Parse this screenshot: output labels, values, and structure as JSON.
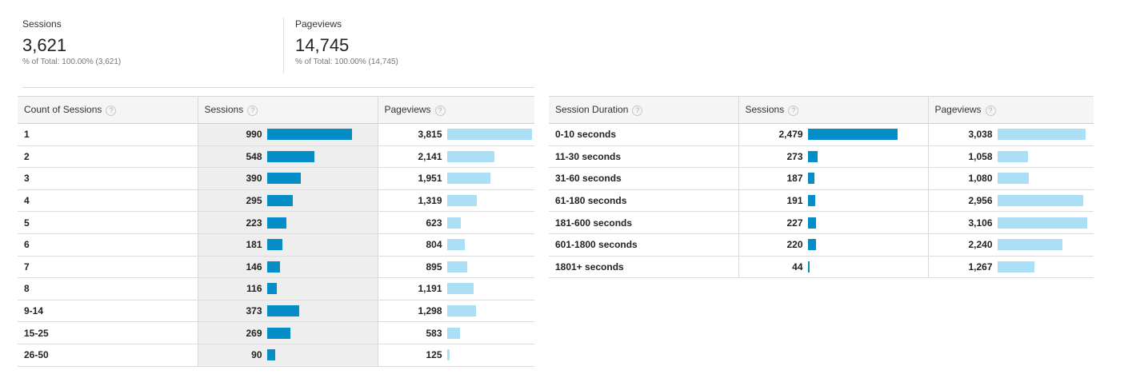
{
  "summary": {
    "sessions": {
      "label": "Sessions",
      "value": "3,621",
      "sub": "% of Total: 100.00% (3,621)"
    },
    "pageviews": {
      "label": "Pageviews",
      "value": "14,745",
      "sub": "% of Total: 100.00% (14,745)"
    }
  },
  "colors": {
    "sessions_bar": "#058dc7",
    "pageviews_bar": "#aadff5"
  },
  "help_icon": "?",
  "table_count": {
    "headers": [
      "Count of Sessions",
      "Sessions",
      "Pageviews"
    ],
    "rows": [
      {
        "dim": "1",
        "sessions": "990",
        "pageviews": "3,815",
        "s": 990,
        "p": 3815
      },
      {
        "dim": "2",
        "sessions": "548",
        "pageviews": "2,141",
        "s": 548,
        "p": 2141
      },
      {
        "dim": "3",
        "sessions": "390",
        "pageviews": "1,951",
        "s": 390,
        "p": 1951
      },
      {
        "dim": "4",
        "sessions": "295",
        "pageviews": "1,319",
        "s": 295,
        "p": 1319
      },
      {
        "dim": "5",
        "sessions": "223",
        "pageviews": "623",
        "s": 223,
        "p": 623
      },
      {
        "dim": "6",
        "sessions": "181",
        "pageviews": "804",
        "s": 181,
        "p": 804
      },
      {
        "dim": "7",
        "sessions": "146",
        "pageviews": "895",
        "s": 146,
        "p": 895
      },
      {
        "dim": "8",
        "sessions": "116",
        "pageviews": "1,191",
        "s": 116,
        "p": 1191
      },
      {
        "dim": "9-14",
        "sessions": "373",
        "pageviews": "1,298",
        "s": 373,
        "p": 1298
      },
      {
        "dim": "15-25",
        "sessions": "269",
        "pageviews": "583",
        "s": 269,
        "p": 583
      },
      {
        "dim": "26-50",
        "sessions": "90",
        "pageviews": "125",
        "s": 90,
        "p": 125
      }
    ]
  },
  "table_duration": {
    "headers": [
      "Session Duration",
      "Sessions",
      "Pageviews"
    ],
    "rows": [
      {
        "dim": "0-10 seconds",
        "sessions": "2,479",
        "pageviews": "3,038",
        "s": 2479,
        "p": 3038
      },
      {
        "dim": "11-30 seconds",
        "sessions": "273",
        "pageviews": "1,058",
        "s": 273,
        "p": 1058
      },
      {
        "dim": "31-60 seconds",
        "sessions": "187",
        "pageviews": "1,080",
        "s": 187,
        "p": 1080
      },
      {
        "dim": "61-180 seconds",
        "sessions": "191",
        "pageviews": "2,956",
        "s": 191,
        "p": 2956
      },
      {
        "dim": "181-600 seconds",
        "sessions": "227",
        "pageviews": "3,106",
        "s": 227,
        "p": 3106
      },
      {
        "dim": "601-1800 seconds",
        "sessions": "220",
        "pageviews": "2,240",
        "s": 220,
        "p": 2240
      },
      {
        "dim": "1801+ seconds",
        "sessions": "44",
        "pageviews": "1,267",
        "s": 44,
        "p": 1267
      }
    ]
  }
}
